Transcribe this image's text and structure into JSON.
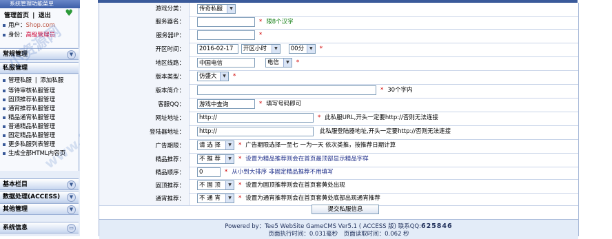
{
  "sidebar": {
    "header": "系统管理功能菜单",
    "manage_home": "管理首页",
    "logout": "退出",
    "user_label": "用户：",
    "user_value": "Shop.com",
    "role_label": "身份：",
    "role_value": "高级管理员",
    "sections": [
      {
        "label": "常规管理",
        "expanded": false
      },
      {
        "label": "私服管理",
        "expanded": true
      },
      {
        "label": "基本栏目",
        "expanded": false
      },
      {
        "label": "数据处理(ACCESS)",
        "expanded": false
      },
      {
        "label": "其他管理",
        "expanded": false
      },
      {
        "label": "系统信息",
        "expanded": false
      }
    ],
    "sifu_links": {
      "manage": "管理私服",
      "separator": "|",
      "add": "添加私服",
      "items": [
        "等待审核私服管理",
        "固顶推荐私服管理",
        "通宵推荐私服管理",
        "精品通宵私服管理",
        "普通精品私服管理",
        "固定精品私服管理",
        "更多私服列表管理",
        "生成全部HTML内容页"
      ]
    }
  },
  "watermark": {
    "line1": "小资源网",
    "line2": "www.hmzyovip.com"
  },
  "form": {
    "rows": [
      {
        "label": "游戏分类：",
        "type": "select",
        "value": "传奇私服",
        "hint": ""
      },
      {
        "label": "服务器名：",
        "type": "input",
        "value": "",
        "star": true,
        "hint": "限8个汉字"
      },
      {
        "label": "服务器IP：",
        "type": "input",
        "value": "",
        "star": true,
        "hint": ""
      },
      {
        "label": "开区时间：",
        "type": "datetime",
        "date": "2016-02-17",
        "time_select": "开区小时",
        "minute_select": "00分",
        "star": true
      },
      {
        "label": "地区线路：",
        "type": "region",
        "value": "中国电信",
        "select": "电信",
        "star": true
      },
      {
        "label": "版本类型：",
        "type": "select",
        "value": "仿盛大",
        "star": true
      },
      {
        "label": "版本简介：",
        "type": "input",
        "value": "",
        "star": true,
        "hint": "30个字内"
      },
      {
        "label": "客服QQ：",
        "type": "input",
        "value": "游戏中查询",
        "star": true,
        "hint": "填写号码即可"
      },
      {
        "label": "网址地址：",
        "type": "input",
        "value": "http://",
        "star": true,
        "hint": "此私服URL,开头一定要http://否则无法连接"
      },
      {
        "label": "登陆器地址：",
        "type": "input",
        "value": "http://",
        "star": false,
        "hint": "此私服登陆器地址,开头一定要http://否则无法连接"
      },
      {
        "label": "广告期限：",
        "type": "select",
        "value": "请 选 择",
        "star": true,
        "hint": "广告期限选择一至七 一为一天 依次类推，按推荐日期计算"
      },
      {
        "label": "精品推荐：",
        "type": "select",
        "value": "不 推 荐",
        "star": true,
        "hint": "设置为精品推荐则会在首页最顶部显示精品字样"
      },
      {
        "label": "精品顺序：",
        "type": "input",
        "value": "0",
        "star": true,
        "hint": "从小到大排序 非固定精品推荐不用填写"
      },
      {
        "label": "固顶推荐：",
        "type": "select",
        "value": "不 固 顶",
        "star": true,
        "hint": "设置为固顶推荐则会在首页套黄处出现"
      },
      {
        "label": "通宵推荐：",
        "type": "select",
        "value": "不 通 宵",
        "star": true,
        "hint": "设置为通宵推荐则会在首页套黄处底部出现通宵推荐"
      }
    ],
    "submit_label": "提交私服信息"
  },
  "footer": {
    "powered": "Powered by：Tee5 WebSite GameCMS Ver5.1 ( ACCESS 版) 联系QQ:",
    "qq": "625846",
    "exec_time": "页面执行时间：0.031毫秒　页面读取时间：0.062 秒"
  },
  "colors": {
    "sidebar_bg": "#e6edf8",
    "accent": "#3a5a9a",
    "star": "#d00000"
  }
}
